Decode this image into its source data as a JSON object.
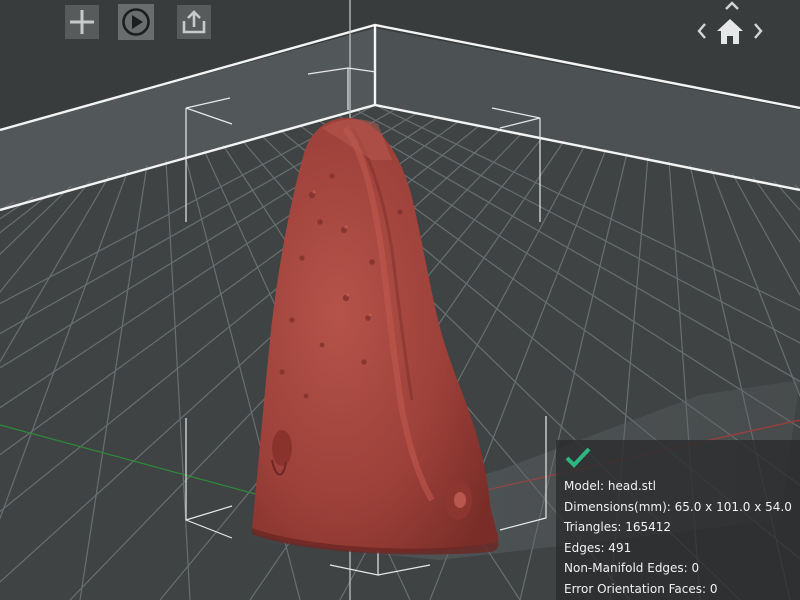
{
  "toolbar": {
    "add_icon": "plus-icon",
    "play_icon": "play-circle-icon",
    "export_icon": "export-tray-icon",
    "active_button": "play"
  },
  "view_nav": {
    "icons": [
      "chevron-up-icon",
      "chevron-left-icon",
      "home-icon",
      "chevron-right-icon"
    ]
  },
  "model_info": {
    "status_icon": "checkmark-icon",
    "status_color": "#2fb580",
    "model": "Model: head.stl",
    "dimensions": "Dimensions(mm): 65.0 x 101.0 x 54.0",
    "triangles": "Triangles: 165412",
    "edges": "Edges: 491",
    "non_manifold": "Non-Manifold Edges: 0",
    "error_faces": "Error Orientation Faces: 0"
  },
  "colors": {
    "background": "#3a3d3e",
    "model": "#a8463f",
    "grid": "#6f7476",
    "frame": "#ffffff"
  }
}
